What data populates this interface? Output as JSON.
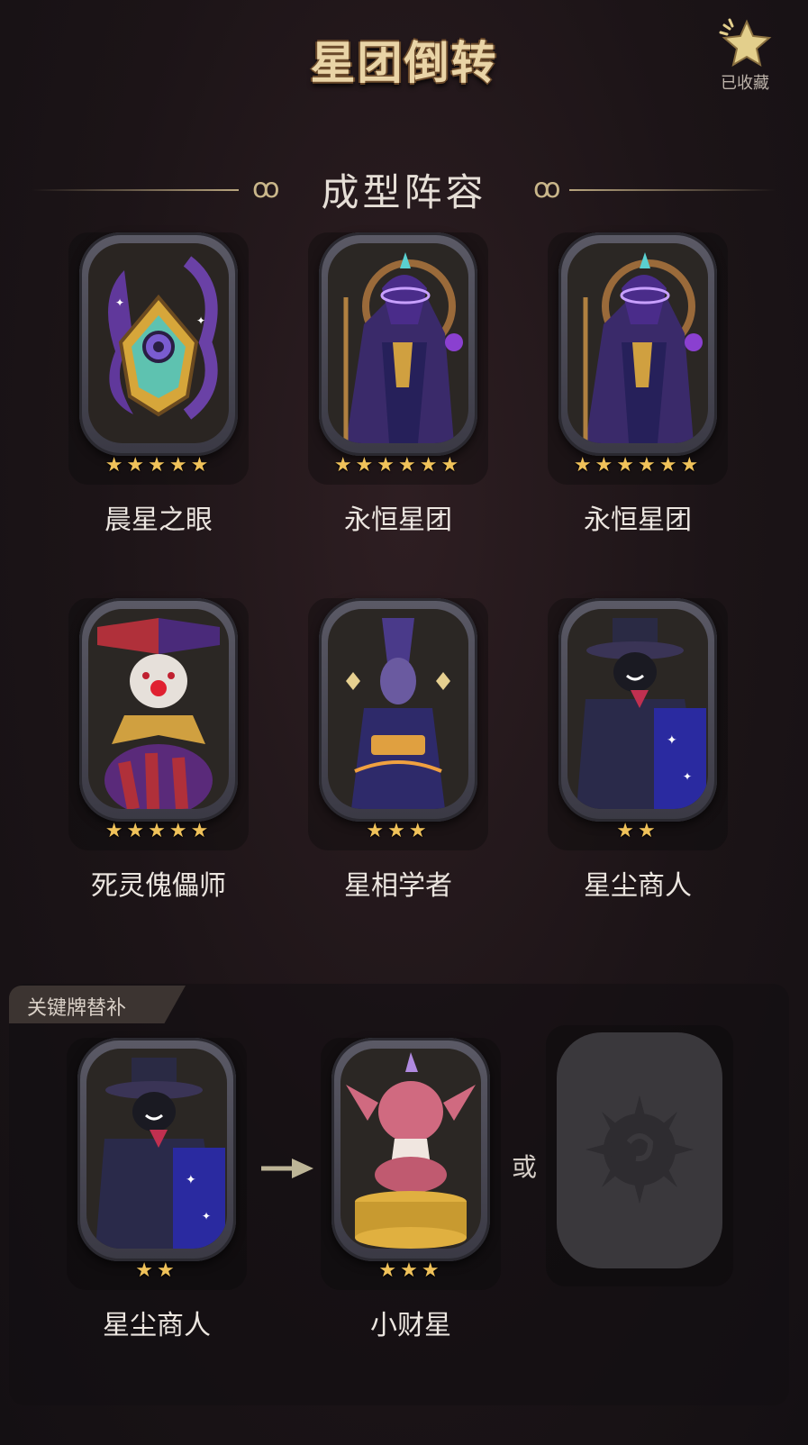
{
  "header": {
    "title": "星团倒转",
    "favorite_label": "已收藏"
  },
  "section": {
    "title": "成型阵容"
  },
  "lineup": [
    {
      "name": "晨星之眼",
      "stars": "★★★★★"
    },
    {
      "name": "永恒星团",
      "stars": "★★★★★★"
    },
    {
      "name": "永恒星团",
      "stars": "★★★★★★"
    },
    {
      "name": "死灵傀儡师",
      "stars": "★★★★★"
    },
    {
      "name": "星相学者",
      "stars": "★★★"
    },
    {
      "name": "星尘商人",
      "stars": "★★"
    }
  ],
  "replacement": {
    "label": "关键牌替补",
    "from": {
      "name": "星尘商人",
      "stars": "★★"
    },
    "to": {
      "name": "小财星",
      "stars": "★★★"
    },
    "or_text": "或"
  },
  "colors": {
    "accent_gold": "#f0c25a",
    "title_gold": "#e9d4a6",
    "frame": "#4a4955"
  },
  "icons": [
    "star-favorite-icon",
    "swirl-ornament-icon",
    "arrow-right-icon",
    "placeholder-sun-icon"
  ]
}
